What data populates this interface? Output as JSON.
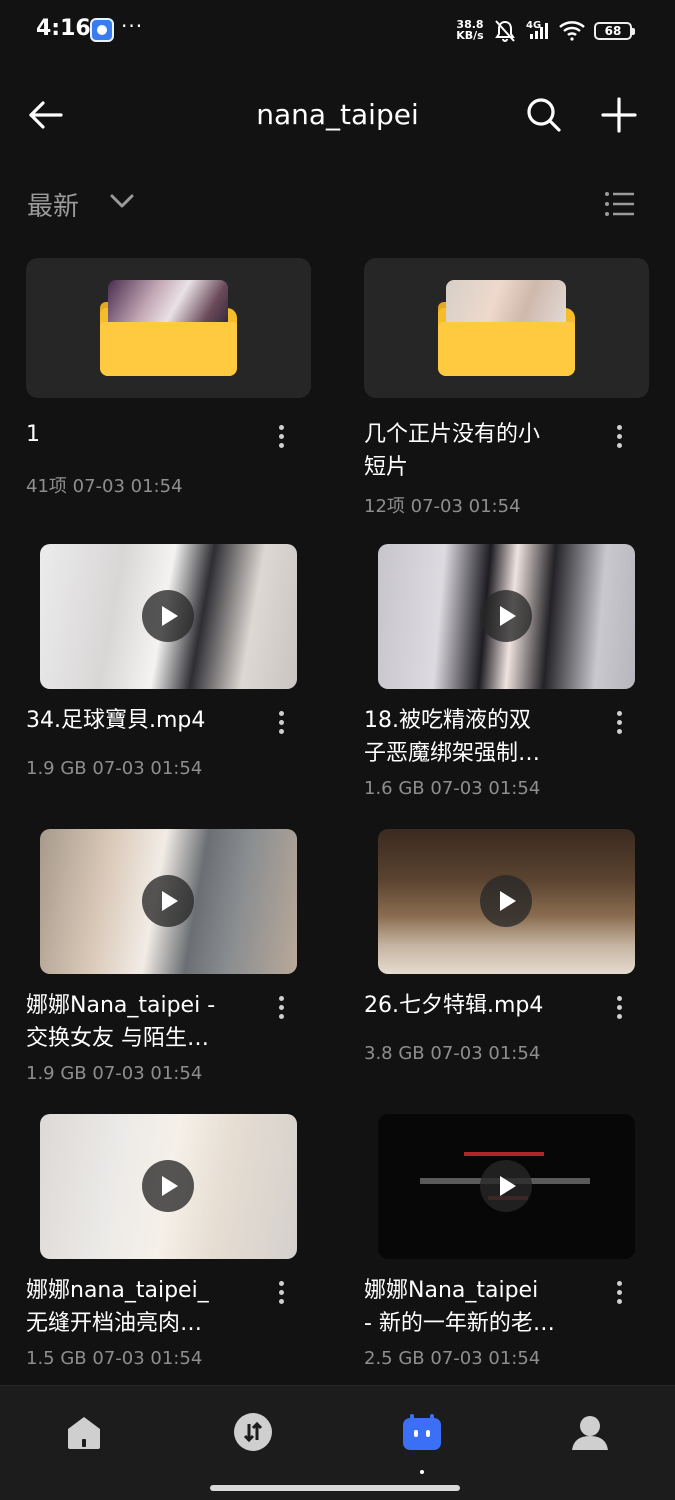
{
  "status_bar": {
    "time": "4:16",
    "more": "···",
    "net_speed_value": "38.8",
    "net_speed_unit": "KB/s",
    "network": "4G",
    "battery": "68"
  },
  "header": {
    "title": "nana_taipei",
    "back_icon": "arrow-left-icon",
    "search_icon": "search-icon",
    "add_icon": "plus-icon"
  },
  "toolbar": {
    "sort_label": "最新",
    "sort_icon": "chevron-down-icon",
    "view_icon": "list-view-icon"
  },
  "items": [
    {
      "type": "folder",
      "name": "1",
      "meta": "41项  07-03 01:54"
    },
    {
      "type": "folder",
      "name": "几个正片没有的小\n短片",
      "meta": "12项  07-03 01:54"
    },
    {
      "type": "video",
      "name": "34.足球寶貝.mp4",
      "meta": "1.9 GB  07-03 01:54"
    },
    {
      "type": "video",
      "name": "18.被吃精液的双\n子恶魔绑架强制…",
      "meta": "1.6 GB  07-03 01:54"
    },
    {
      "type": "video",
      "name": "娜娜Nana_taipei -\n交换女友 与陌生…",
      "meta": "1.9 GB  07-03 01:54"
    },
    {
      "type": "video",
      "name": "26.七夕特辑.mp4",
      "meta": "3.8 GB  07-03 01:54"
    },
    {
      "type": "video",
      "name": "娜娜nana_taipei_\n无缝开档油亮肉…",
      "meta": "1.5 GB  07-03 01:54"
    },
    {
      "type": "video",
      "name": "娜娜Nana_taipei\n- 新的一年新的老…",
      "meta": "2.5 GB  07-03 01:54"
    }
  ],
  "bottom_nav": [
    {
      "icon": "home-icon",
      "active": false
    },
    {
      "icon": "transfer-icon",
      "active": false
    },
    {
      "icon": "files-icon",
      "active": true
    },
    {
      "icon": "profile-icon",
      "active": false
    }
  ],
  "colors": {
    "background": "#121212",
    "folder": "#ffc940",
    "accent": "#3b6ff5",
    "meta_text": "#8e8e8e"
  }
}
